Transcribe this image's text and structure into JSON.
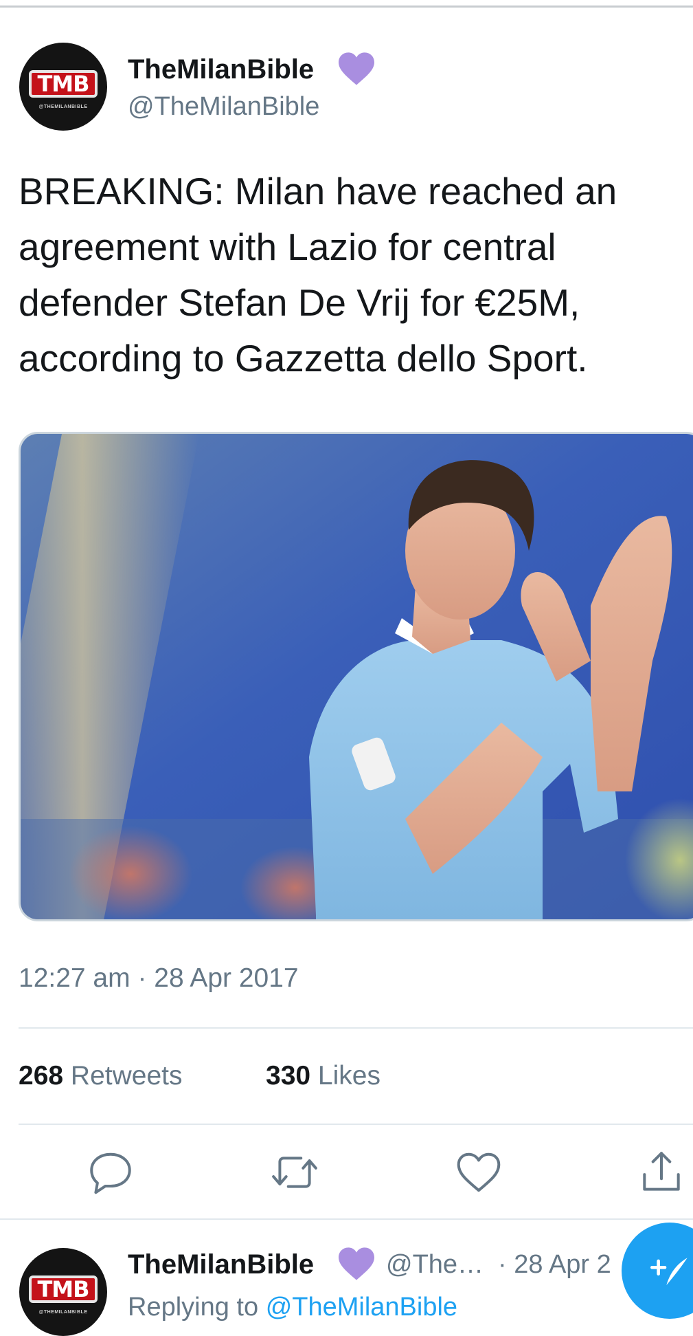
{
  "tweet": {
    "author": {
      "display_name": "TheMilanBible",
      "handle": "@TheMilanBible",
      "avatar_text": "TMB",
      "avatar_subtext": "@THEMILANBIBLE",
      "badge_color": "#a98ee0"
    },
    "text": "BREAKING: Milan have reached an agreement with Lazio for central defender Stefan De Vrij for €25M, according to Gazzetta dello Sport.",
    "timestamp": "12:27 am · 28 Apr 2017",
    "stats": {
      "retweets_count": "268",
      "retweets_label": "Retweets",
      "likes_count": "330",
      "likes_label": "Likes"
    },
    "actions": [
      "reply-icon",
      "retweet-icon",
      "like-icon",
      "share-icon"
    ]
  },
  "reply": {
    "display_name": "TheMilanBible",
    "handle": "@The…",
    "date": "· 28 Apr 2",
    "replying_prefix": "Replying to",
    "replying_handle": "@TheMilanBible"
  },
  "fab": {
    "icon": "compose-icon",
    "color": "#1da1f2"
  },
  "colors": {
    "text": "#14171a",
    "secondary": "#657786",
    "accent": "#1da1f2",
    "divider": "#e1e8ed"
  }
}
